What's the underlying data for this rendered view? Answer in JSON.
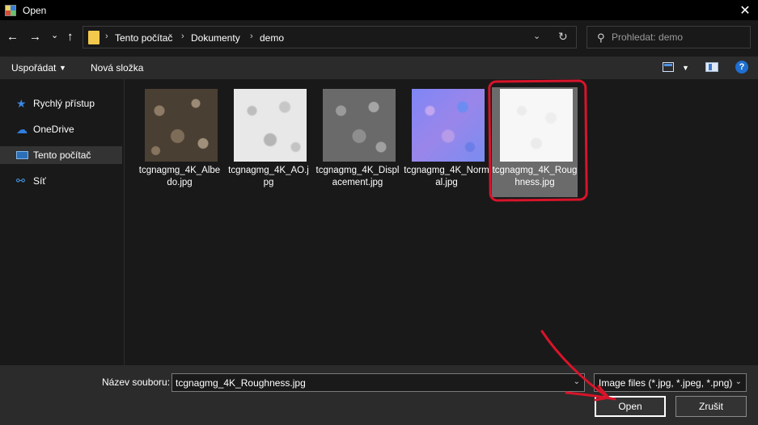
{
  "window": {
    "title": "Open",
    "close_glyph": "✕"
  },
  "nav": {
    "back_glyph": "←",
    "forward_glyph": "→",
    "recent_glyph": "⌄",
    "up_glyph": "↑",
    "breadcrumb": [
      "Tento počítač",
      "Dokumenty",
      "demo"
    ],
    "sep_glyph": "›",
    "dropdown_glyph": "⌄",
    "refresh_glyph": "↻"
  },
  "search": {
    "placeholder": "Prohledat: demo",
    "icon_glyph": "⚲"
  },
  "toolbar": {
    "organize_label": "Uspořádat",
    "organize_caret": "▼",
    "new_folder_label": "Nová složka",
    "view_caret": "▼",
    "help_glyph": "?"
  },
  "sidebar": {
    "items": [
      {
        "label": "Rychlý přístup",
        "icon": "quick-access-icon",
        "glyph": "★"
      },
      {
        "label": "OneDrive",
        "icon": "onedrive-icon",
        "glyph": "☁"
      },
      {
        "label": "Tento počítač",
        "icon": "this-pc-icon",
        "glyph": ""
      },
      {
        "label": "Síť",
        "icon": "network-icon",
        "glyph": "⚯"
      }
    ],
    "selected_index": 2
  },
  "files": [
    {
      "name": "tcgnagmg_4K_Albedo.jpg",
      "thumb": "albedo"
    },
    {
      "name": "tcgnagmg_4K_AO.jpg",
      "thumb": "ao"
    },
    {
      "name": "tcgnagmg_4K_Displacement.jpg",
      "thumb": "disp"
    },
    {
      "name": "tcgnagmg_4K_Normal.jpg",
      "thumb": "normal"
    },
    {
      "name": "tcgnagmg_4K_Roughness.jpg",
      "thumb": "rough"
    }
  ],
  "selected_file_index": 4,
  "footer": {
    "filename_label": "Název souboru:",
    "filename_value": "tcgnagmg_4K_Roughness.jpg",
    "filter_value": "Image files (*.jpg, *.jpeg, *.png)",
    "dropdown_glyph": "⌄",
    "open_label": "Open",
    "cancel_label": "Zrušit"
  },
  "colors": {
    "background": "#191919",
    "toolbar": "#2b2b2b",
    "selection": "#6b6b6b",
    "annotation": "#d8142a",
    "accent": "#1f6fd1"
  }
}
